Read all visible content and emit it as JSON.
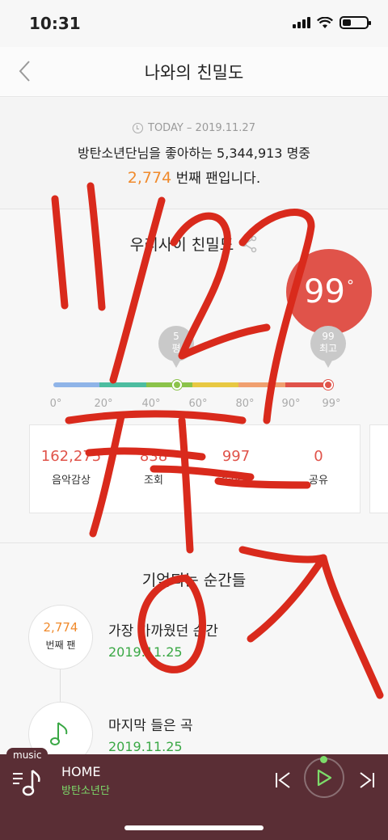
{
  "status_bar": {
    "time": "10:31"
  },
  "nav": {
    "title": "나와의 친밀도"
  },
  "summary": {
    "today": "TODAY – 2019.11.27",
    "sentence": "방탄소년단님을 좋아하는 5,344,913 명중",
    "rank": "2,774",
    "rank_suffix": " 번째 팬입니다."
  },
  "intimacy": {
    "title": "우리사이 친밀도",
    "degree": "99",
    "degree_unit": "°",
    "my_marker": {
      "line1": "5",
      "line2": "평"
    },
    "max_marker": {
      "line1": "99",
      "line2": "최고"
    },
    "scale_labels": [
      "0°",
      "20°",
      "40°",
      "60°",
      "80°",
      "90°",
      "99°"
    ],
    "scale_colors": [
      "#8fb4e8",
      "#4dbda0",
      "#8bc34a",
      "#e8c842",
      "#f0a070",
      "#e0534a"
    ],
    "stats": [
      {
        "value": "162,275",
        "label": "음악감상"
      },
      {
        "value": "838",
        "label": "조회"
      },
      {
        "value": "997",
        "label": "좋아요"
      },
      {
        "value": "0",
        "label": "공유"
      }
    ]
  },
  "moments": {
    "title": "기억되는 순간들",
    "items": [
      {
        "badge_num": "2,774",
        "badge_sub": "번째 팬",
        "title": "가장 가까웠던 순간",
        "date": "2019.11.25"
      },
      {
        "icon": "music-note-icon",
        "title": "마지막 들은 곡",
        "date": "2019.11.25"
      }
    ]
  },
  "player": {
    "tab": "music",
    "song": "HOME",
    "artist": "방탄소년단"
  },
  "colors": {
    "accent_orange": "#f08a2c",
    "accent_red": "#e0534a",
    "accent_green": "#3aa845",
    "player_bg": "#5a2e35"
  }
}
